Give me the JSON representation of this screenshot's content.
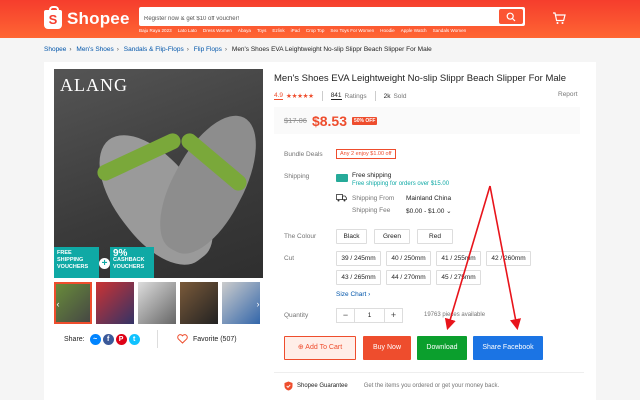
{
  "header": {
    "logo_text": "Shopee",
    "search_placeholder": "Register now & get $10 off voucher!",
    "quick_links": [
      "Baju Raya 2023",
      "Lato Lato",
      "Dress Women",
      "Abaya",
      "Toys",
      "Ezlink",
      "iPad",
      "Crop Top",
      "Sex Toys For Women",
      "Hoodie",
      "Apple Watch",
      "Sandals Women"
    ]
  },
  "breadcrumb": [
    "Shopee",
    "Men's Shoes",
    "Sandals & Flip-Flops",
    "Flip Flops",
    "Men's Shoes EVA Leightweight No-slip Slippr Beach Slipper For Male"
  ],
  "product": {
    "image_brand": "ALANG",
    "promo": {
      "free_shipping": "FREE SHIPPING VOUCHERS",
      "plus": "+",
      "cashback_pct": "9%",
      "cashback": "CASHBACK VOUCHERS"
    },
    "title": "Men's Shoes EVA Leightweight No-slip Slippr Beach Slipper For Male",
    "rating": "4.9",
    "stars": "★★★★★",
    "ratings_count": "841",
    "ratings_label": "Ratings",
    "sold_count": "2k",
    "sold_label": "Sold",
    "report": "Report",
    "old_price": "$17.06",
    "new_price": "$8.53",
    "discount": "50% OFF",
    "bundle_label": "Bundle Deals",
    "bundle_deal": "Any 2 enjoy $1.00 off",
    "shipping_label": "Shipping",
    "free_shipping": "Free shipping",
    "free_shipping_note": "Free shipping for orders over $15.00",
    "ship_from_label": "Shipping From",
    "ship_from": "Mainland China",
    "ship_fee_label": "Shipping Fee",
    "ship_fee": "$0.00 - $1.00",
    "colour_label": "The Colour",
    "colours": [
      "Black",
      "Green",
      "Red"
    ],
    "cut_label": "Cut",
    "sizes_row1": [
      "39 / 245mm",
      "40 / 250mm",
      "41 / 255mm",
      "42 / 260mm"
    ],
    "sizes_row2": [
      "43 / 265mm",
      "44 / 270mm",
      "45 / 275mm"
    ],
    "size_chart": "Size Chart",
    "quantity_label": "Quantity",
    "quantity": "1",
    "minus": "−",
    "plus": "+",
    "available": "19763 pieces available",
    "add_to_cart": "Add To Cart",
    "buy_now": "Buy Now",
    "download": "Download",
    "share_facebook": "Share Facebook",
    "share_label": "Share:",
    "favorite": "Favorite (507)",
    "guarantee_title": "Shopee Guarantee",
    "guarantee_desc": "Get the items you ordered or get your money back."
  },
  "colors": {
    "brand": "#ee4d2d",
    "download": "#0b9f2d",
    "facebook": "#1b74e4",
    "arrow": "#e8141b"
  }
}
